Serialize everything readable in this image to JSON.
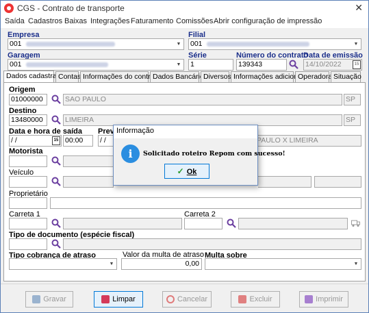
{
  "window": {
    "title": "CGS - Contrato de transporte",
    "close_glyph": "✕"
  },
  "menu": [
    "Saída",
    "Cadastros",
    "Baixas",
    "Integrações",
    "Faturamento",
    "Comissões",
    "Abrir configuração de impressão"
  ],
  "header": {
    "empresa_label": "Empresa",
    "empresa_value": "001",
    "filial_label": "Filial",
    "filial_value": "001",
    "garagem_label": "Garagem",
    "garagem_value": "001",
    "serie_label": "Série",
    "serie_value": "1",
    "numero_label": "Número do contrato",
    "numero_value": "139343",
    "emissao_label": "Data de emissão",
    "emissao_value": "14/10/2022"
  },
  "tabs": [
    "Dados cadastrais",
    "Contas",
    "Informações do contrato",
    "Dados Bancários",
    "Diversos",
    "Informações adicionais",
    "Operadoras",
    "Situação"
  ],
  "form": {
    "origem_label": "Origem",
    "origem_code": "01000000",
    "origem_city": "SAO PAULO",
    "origem_uf": "SP",
    "destino_label": "Destino",
    "destino_code": "13480000",
    "destino_city": "LIMEIRA",
    "destino_uf": "SP",
    "saida_label": "Data e hora de saída",
    "saida_date": " / /",
    "saida_time": "00:00",
    "previsao_label": "Previ",
    "previsao_date": " / /",
    "rota_value": "PAULO X LIMEIRA",
    "motorista_label": "Motorista",
    "veiculo_label": "Veículo",
    "proprietario_label": "Proprietário",
    "carreta1_label": "Carreta 1",
    "carreta2_label": "Carreta 2",
    "tipo_doc_label": "Tipo de documento (espécie fiscal)",
    "tipo_cobranca_label": "Tipo cobrança de atraso",
    "valor_multa_label": "Valor da multa de atraso",
    "valor_multa_value": "0,00",
    "multa_sobre_label": "Multa sobre"
  },
  "buttons": {
    "gravar": "Gravar",
    "limpar": "Limpar",
    "cancelar": "Cancelar",
    "excluir": "Excluir",
    "imprimir": "Imprimir"
  },
  "dialog": {
    "title": "Informação",
    "icon": "i",
    "message": "Solicitado roteiro Repom com sucesso!",
    "ok": "Ok",
    "ok_check": "✓"
  },
  "colors": {
    "label_blue": "#1a2e8a",
    "accent": "#0078d7",
    "info_blue": "#2b8ee0",
    "app_red": "#e33333"
  }
}
